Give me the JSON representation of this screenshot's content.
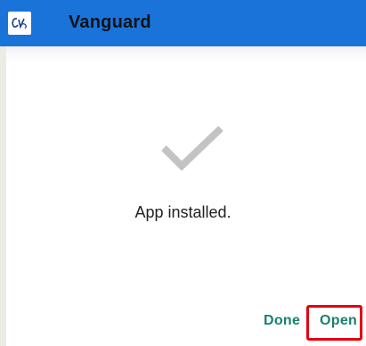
{
  "app_bar": {
    "title": "Vanguard",
    "logo_icon": "vanguard-logo-icon",
    "background_color": "#1a73d9"
  },
  "dialog": {
    "status_icon": "checkmark-icon",
    "message": "App installed.",
    "done_label": "Done",
    "open_label": "Open",
    "button_color": "#18806f",
    "highlight_color": "#e3000f"
  }
}
